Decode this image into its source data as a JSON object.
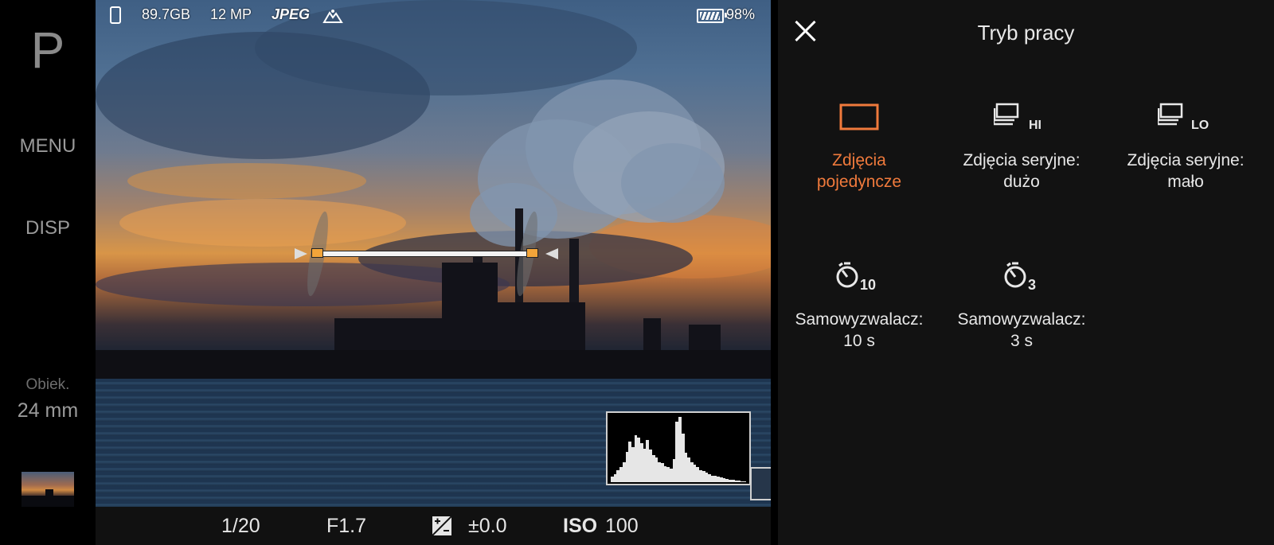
{
  "app": {
    "mode": "P",
    "menu_label": "MENU",
    "disp_label": "DISP",
    "lens_title": "Obiek.",
    "lens_value": "24 mm"
  },
  "status": {
    "storage": "89.7GB",
    "megapixels": "12 MP",
    "format": "JPEG",
    "battery": "98%"
  },
  "exposure": {
    "shutter": "1/20",
    "aperture": "F1.7",
    "ev": "±0.0",
    "iso_label": "ISO",
    "iso_value": "100"
  },
  "histogram": {
    "levels": [
      8,
      12,
      18,
      22,
      30,
      45,
      60,
      52,
      70,
      66,
      58,
      50,
      62,
      48,
      40,
      36,
      30,
      28,
      24,
      22,
      20,
      34,
      90,
      96,
      72,
      44,
      36,
      30,
      26,
      22,
      18,
      16,
      14,
      12,
      10,
      9,
      8,
      7,
      6,
      5,
      4,
      3,
      2,
      2,
      1,
      1
    ]
  },
  "panel": {
    "title": "Tryb pracy",
    "accent_color": "#f07a3c",
    "options": [
      {
        "icon": "single-frame-icon",
        "line1": "Zdjęcia",
        "line2": "pojedyncze",
        "selected": true
      },
      {
        "icon": "burst-hi-icon",
        "line1": "Zdjęcia seryjne:",
        "line2": "dużo",
        "badge": "HI",
        "selected": false
      },
      {
        "icon": "burst-lo-icon",
        "line1": "Zdjęcia seryjne:",
        "line2": "mało",
        "badge": "LO",
        "selected": false
      },
      {
        "icon": "self-timer-10-icon",
        "line1": "Samowyzwalacz:",
        "line2": "10 s",
        "badge": "10",
        "selected": false
      },
      {
        "icon": "self-timer-3-icon",
        "line1": "Samowyzwalacz:",
        "line2": "3 s",
        "badge": "3",
        "selected": false
      }
    ]
  }
}
